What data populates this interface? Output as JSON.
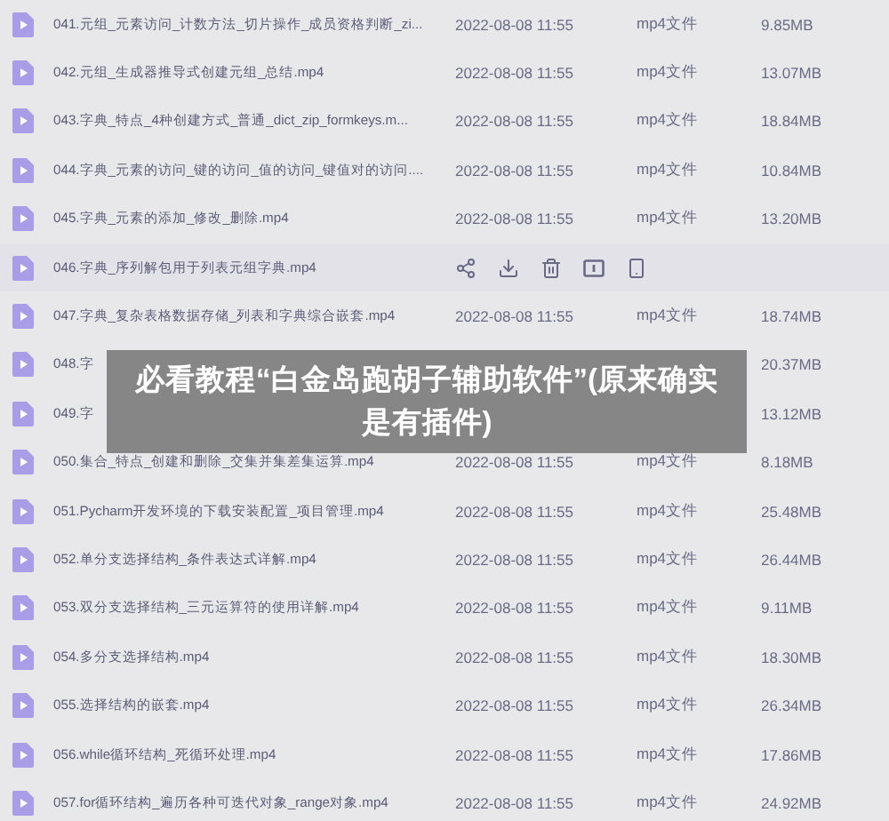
{
  "files": [
    {
      "name": "041.元组_元素访问_计数方法_切片操作_成员资格判断_zi...",
      "date": "2022-08-08 11:55",
      "type": "mp4文件",
      "size": "9.85MB",
      "hovered": false
    },
    {
      "name": "042.元组_生成器推导式创建元组_总结.mp4",
      "date": "2022-08-08 11:55",
      "type": "mp4文件",
      "size": "13.07MB",
      "hovered": false
    },
    {
      "name": "043.字典_特点_4种创建方式_普通_dict_zip_formkeys.m...",
      "date": "2022-08-08 11:55",
      "type": "mp4文件",
      "size": "18.84MB",
      "hovered": false
    },
    {
      "name": "044.字典_元素的访问_键的访问_值的访问_键值对的访问....",
      "date": "2022-08-08 11:55",
      "type": "mp4文件",
      "size": "10.84MB",
      "hovered": false
    },
    {
      "name": "045.字典_元素的添加_修改_删除.mp4",
      "date": "2022-08-08 11:55",
      "type": "mp4文件",
      "size": "13.20MB",
      "hovered": false
    },
    {
      "name": "046.字典_序列解包用于列表元组字典.mp4",
      "hovered": true
    },
    {
      "name": "047.字典_复杂表格数据存储_列表和字典综合嵌套.mp4",
      "date": "2022-08-08 11:55",
      "type": "mp4文件",
      "size": "18.74MB",
      "hovered": false
    },
    {
      "name": "048.字",
      "size": "20.37MB",
      "hovered": false
    },
    {
      "name": "049.字",
      "size": "13.12MB",
      "hovered": false
    },
    {
      "name": "050.集合_特点_创建和删除_交集并集差集运算.mp4",
      "date": "2022-08-08 11:55",
      "type": "mp4文件",
      "size": "8.18MB",
      "hovered": false
    },
    {
      "name": "051.Pycharm开发环境的下载安装配置_项目管理.mp4",
      "date": "2022-08-08 11:55",
      "type": "mp4文件",
      "size": "25.48MB",
      "hovered": false
    },
    {
      "name": "052.单分支选择结构_条件表达式详解.mp4",
      "date": "2022-08-08 11:55",
      "type": "mp4文件",
      "size": "26.44MB",
      "hovered": false
    },
    {
      "name": "053.双分支选择结构_三元运算符的使用详解.mp4",
      "date": "2022-08-08 11:55",
      "type": "mp4文件",
      "size": "9.11MB",
      "hovered": false
    },
    {
      "name": "054.多分支选择结构.mp4",
      "date": "2022-08-08 11:55",
      "type": "mp4文件",
      "size": "18.30MB",
      "hovered": false
    },
    {
      "name": "055.选择结构的嵌套.mp4",
      "date": "2022-08-08 11:55",
      "type": "mp4文件",
      "size": "26.34MB",
      "hovered": false
    },
    {
      "name": "056.while循环结构_死循环处理.mp4",
      "date": "2022-08-08 11:55",
      "type": "mp4文件",
      "size": "17.86MB",
      "hovered": false
    },
    {
      "name": "057.for循环结构_遍历各种可迭代对象_range对象.mp4",
      "date": "2022-08-08 11:55",
      "type": "mp4文件",
      "size": "24.92MB",
      "hovered": false
    }
  ],
  "banner": {
    "text": "必看教程“白金岛跑胡子辅助软件”(原来确实是有插件)"
  }
}
